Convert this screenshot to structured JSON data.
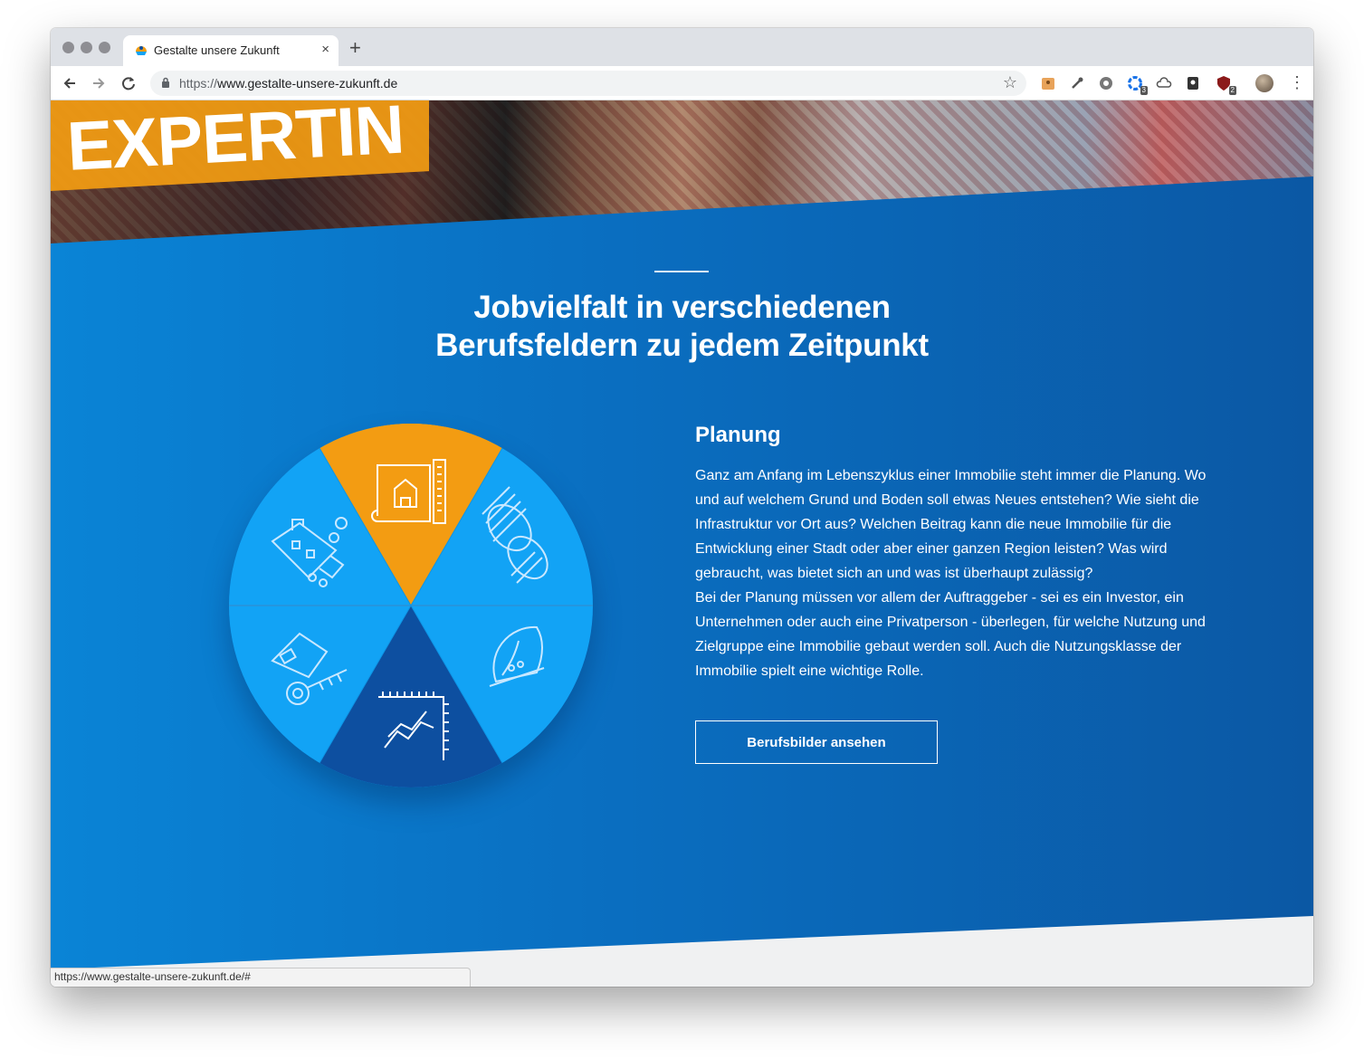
{
  "browser": {
    "tab_title": "Gestalte unsere Zukunft",
    "tab_close": "×",
    "new_tab": "+",
    "url_scheme": "https://",
    "url_host": "www.gestalte-unsere-zukunft.de",
    "badge_ext1": "3",
    "badge_ext2": "2",
    "status_url": "https://www.gestalte-unsere-zukunft.de/#"
  },
  "hero": {
    "banner_word": "EXPERTIN"
  },
  "section": {
    "headline_line1": "Jobvielfalt in verschiedenen",
    "headline_line2": "Berufsfeldern zu jedem Zeitpunkt",
    "active_title": "Planung",
    "paragraph1": "Ganz am Anfang im Lebenszyklus einer Immobilie steht immer die Planung. Wo und auf welchem Grund und Boden soll etwas Neues entstehen? Wie sieht die Infrastruktur vor Ort aus? Welchen Beitrag kann die neue Immobilie für die Entwicklung einer Stadt oder aber einer ganzen Region leisten? Was wird gebraucht, was bietet sich an und was ist überhaupt zulässig?",
    "paragraph2": "Bei der Planung müssen vor allem der Auftraggeber - sei es ein Investor, ein Unternehmen oder auch eine Privatperson - überlegen, für welche Nutzung und Zielgruppe eine Immobilie gebaut werden soll. Auch die Nutzungsklasse der Immobilie spielt eine wichtige Rolle.",
    "cta_label": "Berufsbilder ansehen"
  },
  "colors": {
    "accent_orange": "#f39c12",
    "segment_light_blue": "#12a3f5",
    "segment_dark_blue": "#0d4fa0",
    "section_blue": "#0a6ec0"
  },
  "wheel_icons": [
    "blueprint-house-icon",
    "coins-icon",
    "hardhat-icon",
    "growth-chart-icon",
    "house-key-icon",
    "moving-house-icon"
  ]
}
